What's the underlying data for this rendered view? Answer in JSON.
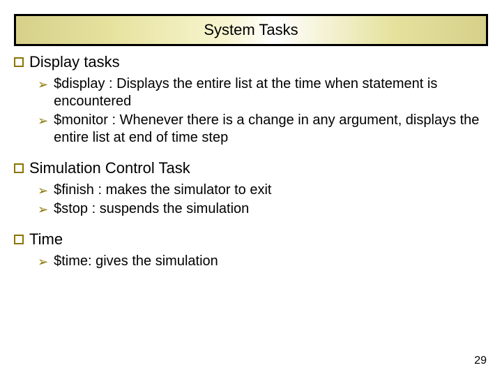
{
  "title": "System Tasks",
  "sections": [
    {
      "heading": "Display tasks",
      "items": [
        "$display : Displays the entire list at the time when statement is encountered",
        "$monitor : Whenever there is a change in any argument, displays the entire list at end of time step"
      ]
    },
    {
      "heading": "Simulation Control Task",
      "items": [
        "$finish : makes the simulator to exit",
        "$stop : suspends the simulation"
      ]
    },
    {
      "heading": "Time",
      "items": [
        "$time: gives the simulation"
      ]
    }
  ],
  "page_number": "29"
}
